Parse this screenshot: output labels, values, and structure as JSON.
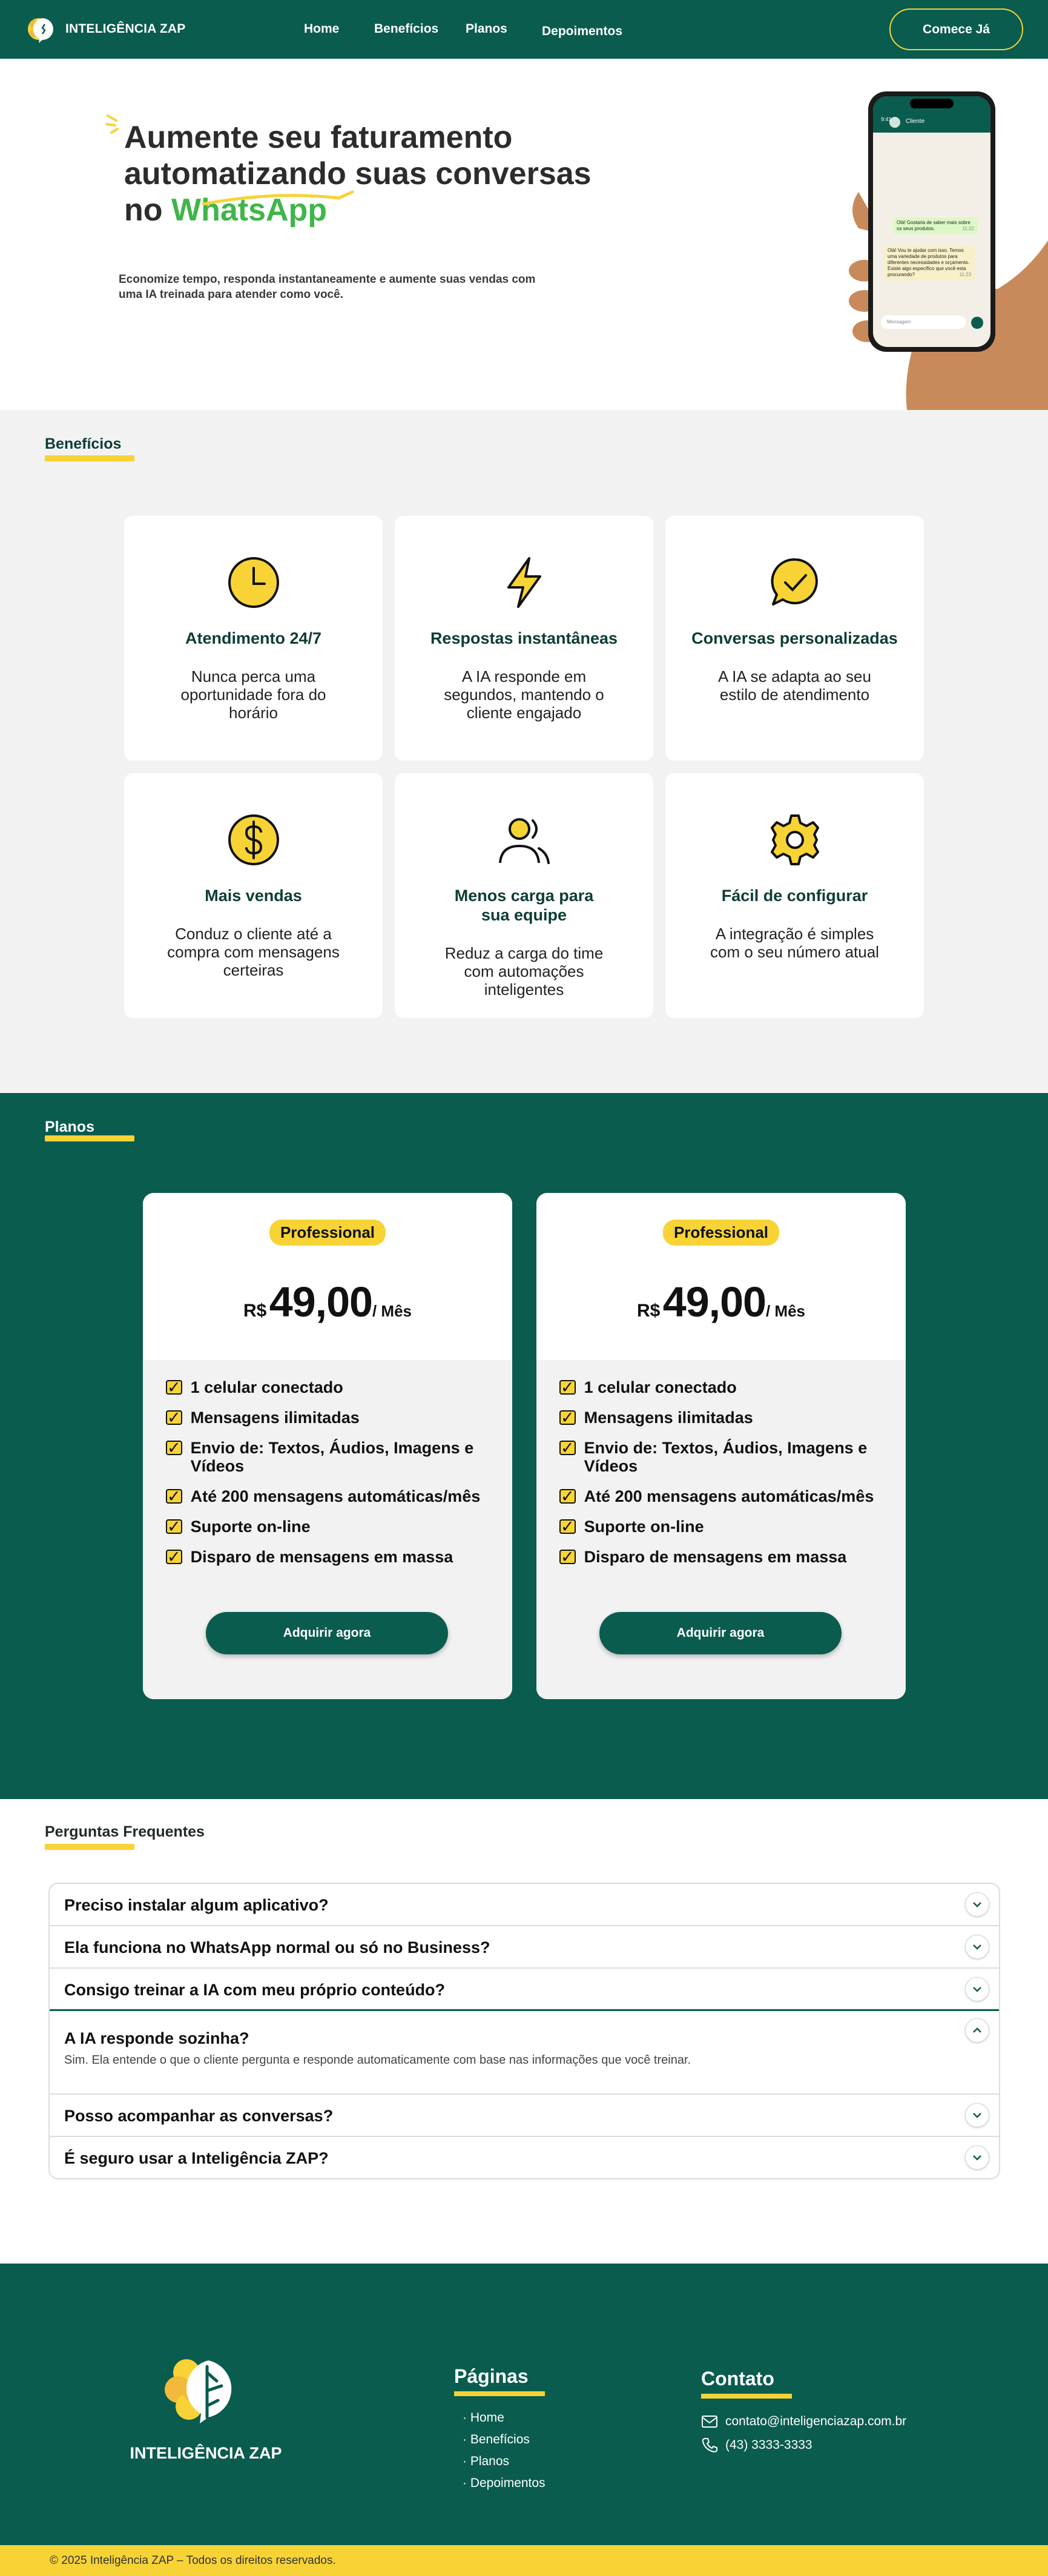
{
  "nav": {
    "brand": "INTELIGÊNCIA ZAP",
    "links": [
      "Home",
      "Benefícios",
      "Planos",
      "Depoimentos"
    ],
    "cta": "Comece Já"
  },
  "hero": {
    "title_line1": "Aumente seu faturamento",
    "title_line2": "automatizando suas conversas",
    "title_line3_prefix": "no ",
    "title_highlight": "WhatsApp",
    "subtitle": "Economize tempo, responda instantaneamente e aumente suas vendas com uma IA treinada para atender como você.",
    "phone": {
      "status_time": "9:41",
      "contact": "Cliente",
      "msg_in": "Olá! Gostaria de saber mais sobre os seus produtos.",
      "msg_in_time": "11:22",
      "msg_out": "Olá! Vou te ajudar com isso. Temos uma variedade de produtos para diferentes necessidades e orçamento. Existe algo específico que você esta procurando?",
      "msg_out_time": "11:23",
      "input_placeholder": "Mensagem"
    }
  },
  "benefits": {
    "title": "Benefícios",
    "items": [
      {
        "icon": "clock-icon",
        "title": "Atendimento 24/7",
        "desc": "Nunca perca uma oportunidade fora do horário"
      },
      {
        "icon": "lightning-icon",
        "title": "Respostas instantâneas",
        "desc": "A IA responde em segundos, mantendo o cliente engajado"
      },
      {
        "icon": "chat-check-icon",
        "title": "Conversas personalizadas",
        "desc": "A IA se adapta ao seu estilo de atendimento"
      },
      {
        "icon": "dollar-icon",
        "title": "Mais vendas",
        "desc": "Conduz o cliente até a compra com mensagens certeiras"
      },
      {
        "icon": "team-icon",
        "title": "Menos carga para sua equipe",
        "desc": "Reduz a carga do time com automações inteligentes"
      },
      {
        "icon": "gear-icon",
        "title": "Fácil de configurar",
        "desc": "A integração é simples com o seu número atual"
      }
    ]
  },
  "plans": {
    "title": "Planos",
    "items": [
      {
        "badge": "Professional",
        "currency": "R$",
        "price": "49,00",
        "period": "/ Mês",
        "features": [
          "1 celular conectado",
          "Mensagens ilimitadas",
          "Envio de: Textos, Áudios, Imagens e Vídeos",
          "Até 200 mensagens automáticas/mês",
          "Suporte on-line",
          "Disparo de mensagens em massa"
        ],
        "button": "Adquirir agora"
      },
      {
        "badge": "Professional",
        "currency": "R$",
        "price": "49,00",
        "period": "/ Mês",
        "features": [
          "1 celular conectado",
          "Mensagens ilimitadas",
          "Envio de: Textos, Áudios, Imagens e Vídeos",
          "Até 200 mensagens automáticas/mês",
          "Suporte on-line",
          "Disparo de mensagens em massa"
        ],
        "button": "Adquirir agora"
      }
    ]
  },
  "faq": {
    "title": "Perguntas Frequentes",
    "items": [
      {
        "q": "Preciso instalar algum aplicativo?",
        "open": false
      },
      {
        "q": "Ela funciona no WhatsApp normal ou só no Business?",
        "open": false
      },
      {
        "q": "Consigo treinar a IA com meu próprio conteúdo?",
        "open": false
      },
      {
        "q": "A IA responde sozinha?",
        "open": true,
        "a": "Sim. Ela entende o que o cliente pergunta e responde automaticamente com base nas informações que você treinar."
      },
      {
        "q": "Posso acompanhar as conversas?",
        "open": false
      },
      {
        "q": "É seguro usar a Inteligência ZAP?",
        "open": false
      }
    ]
  },
  "footer": {
    "brand": "INTELIGÊNCIA ZAP",
    "pages_title": "Páginas",
    "pages": [
      "Home",
      "Benefícios",
      "Planos",
      "Depoimentos"
    ],
    "contact_title": "Contato",
    "email": "contato@inteligenciazap.com.br",
    "phone": "(43) 3333-3333",
    "copyright": "© 2025 Inteligência ZAP – Todos os direitos reservados."
  },
  "colors": {
    "primary": "#0a5c4e",
    "accent": "#f7d336",
    "whatsapp": "#3fb54a",
    "light_bg": "#f2f2f2"
  }
}
